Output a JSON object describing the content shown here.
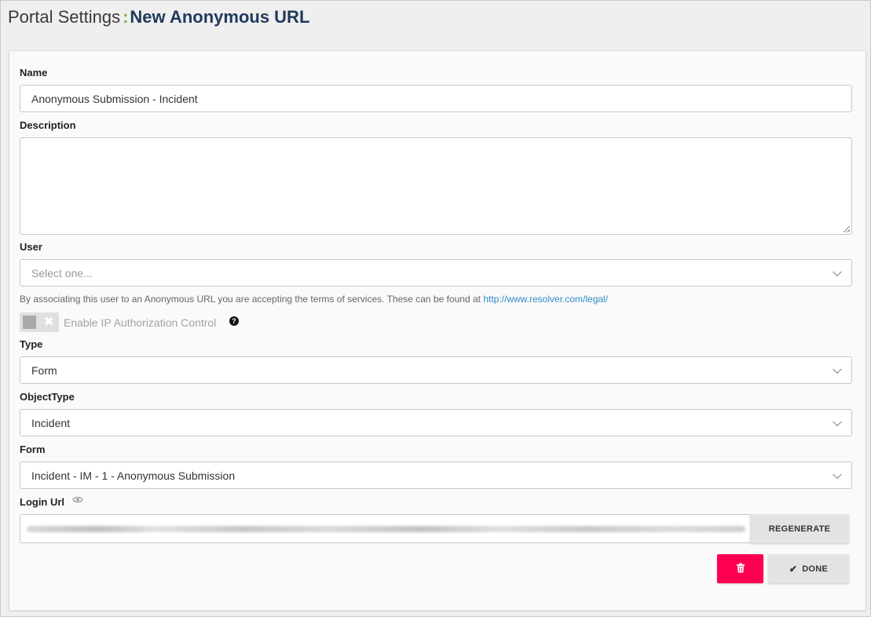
{
  "header": {
    "prefix": "Portal Settings",
    "separator": ":",
    "title": "New Anonymous URL"
  },
  "form": {
    "name": {
      "label": "Name",
      "value": "Anonymous Submission - Incident"
    },
    "description": {
      "label": "Description",
      "value": ""
    },
    "user": {
      "label": "User",
      "placeholder": "Select one...",
      "helper_text": "By associating this user to an Anonymous URL you are accepting the terms of services. These can be found at ",
      "helper_link": "http://www.resolver.com/legal/"
    },
    "ip_toggle": {
      "label": "Enable IP Authorization Control",
      "enabled": false,
      "help_icon": "question-circle-icon"
    },
    "type": {
      "label": "Type",
      "value": "Form"
    },
    "object_type": {
      "label": "ObjectType",
      "value": "Incident"
    },
    "form_select": {
      "label": "Form",
      "value": "Incident - IM - 1 - Anonymous Submission"
    },
    "login_url": {
      "label": "Login Url",
      "icon": "eye-icon",
      "value_obscured": true
    }
  },
  "actions": {
    "regenerate_label": "REGENERATE",
    "done_label": "DONE",
    "delete_icon": "trash-icon",
    "done_icon": "check-icon"
  },
  "colors": {
    "accent_green": "#7ab648",
    "title_navy": "#1f3a5c",
    "delete_red": "#ff0050",
    "link_blue": "#2f8bc7"
  }
}
